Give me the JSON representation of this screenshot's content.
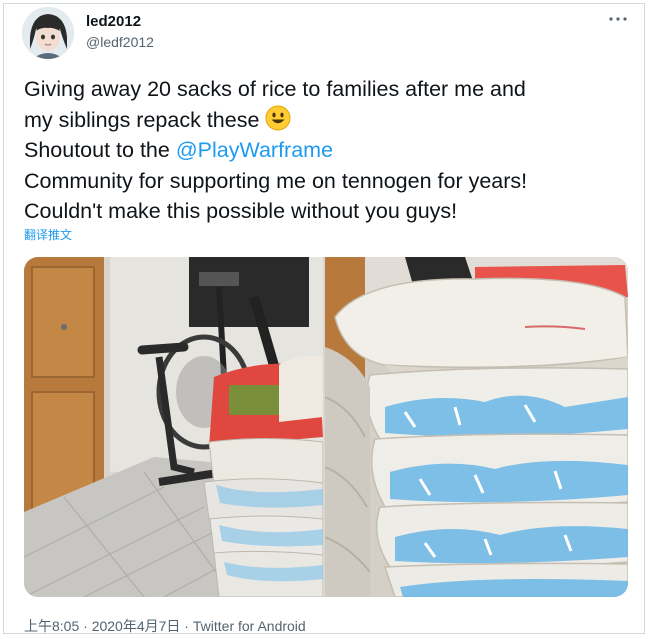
{
  "user": {
    "display_name": "led2012",
    "handle": "@ledf2012"
  },
  "more_icon": "more-horizontal-icon",
  "tweet": {
    "line1": "Giving away 20 sacks of rice to families  after me and",
    "line2": "my siblings repack these",
    "line2_emoji": "smiling-face-emoji",
    "line3_prefix": "Shoutout to the ",
    "mention": "@PlayWarframe",
    "line4": "Community for supporting me on tennogen for years!",
    "line5": "Couldn't make this possible without you guys!"
  },
  "translate_label": "翻译推文",
  "meta": {
    "time": "上午8:05",
    "separator1": " · ",
    "date": "2020年4月7日",
    "separator2": " · ",
    "source": "Twitter for Android"
  },
  "colors": {
    "link": "#1d9bf0",
    "text": "#0f1419",
    "secondary": "#536471",
    "border": "#cfd9de"
  }
}
